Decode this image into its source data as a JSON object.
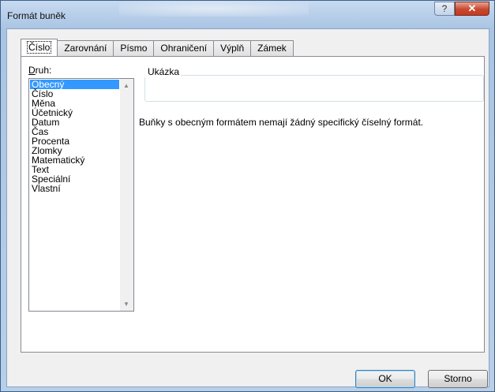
{
  "window": {
    "title": "Formát buněk",
    "help_glyph": "?",
    "close_glyph": "✕"
  },
  "tabs": [
    {
      "label": "Číslo",
      "active": true
    },
    {
      "label": "Zarovnání"
    },
    {
      "label": "Písmo"
    },
    {
      "label": "Ohraničení"
    },
    {
      "label": "Výplň"
    },
    {
      "label": "Zámek"
    }
  ],
  "category": {
    "label_first": "D",
    "label_rest": "ruh:",
    "items": [
      "Obecný",
      "Číslo",
      "Měna",
      "Účetnický",
      "Datum",
      "Čas",
      "Procenta",
      "Zlomky",
      "Matematický",
      "Text",
      "Speciální",
      "Vlastní"
    ],
    "selected": "Obecný"
  },
  "sample": {
    "label": "Ukázka",
    "value": ""
  },
  "description": "Buňky s obecným formátem nemají žádný specifický číselný formát.",
  "buttons": {
    "ok": "OK",
    "cancel": "Storno"
  },
  "colors": {
    "selection": "#3399ff",
    "close_button": "#c8482e",
    "frame": "#a9c4e3"
  }
}
